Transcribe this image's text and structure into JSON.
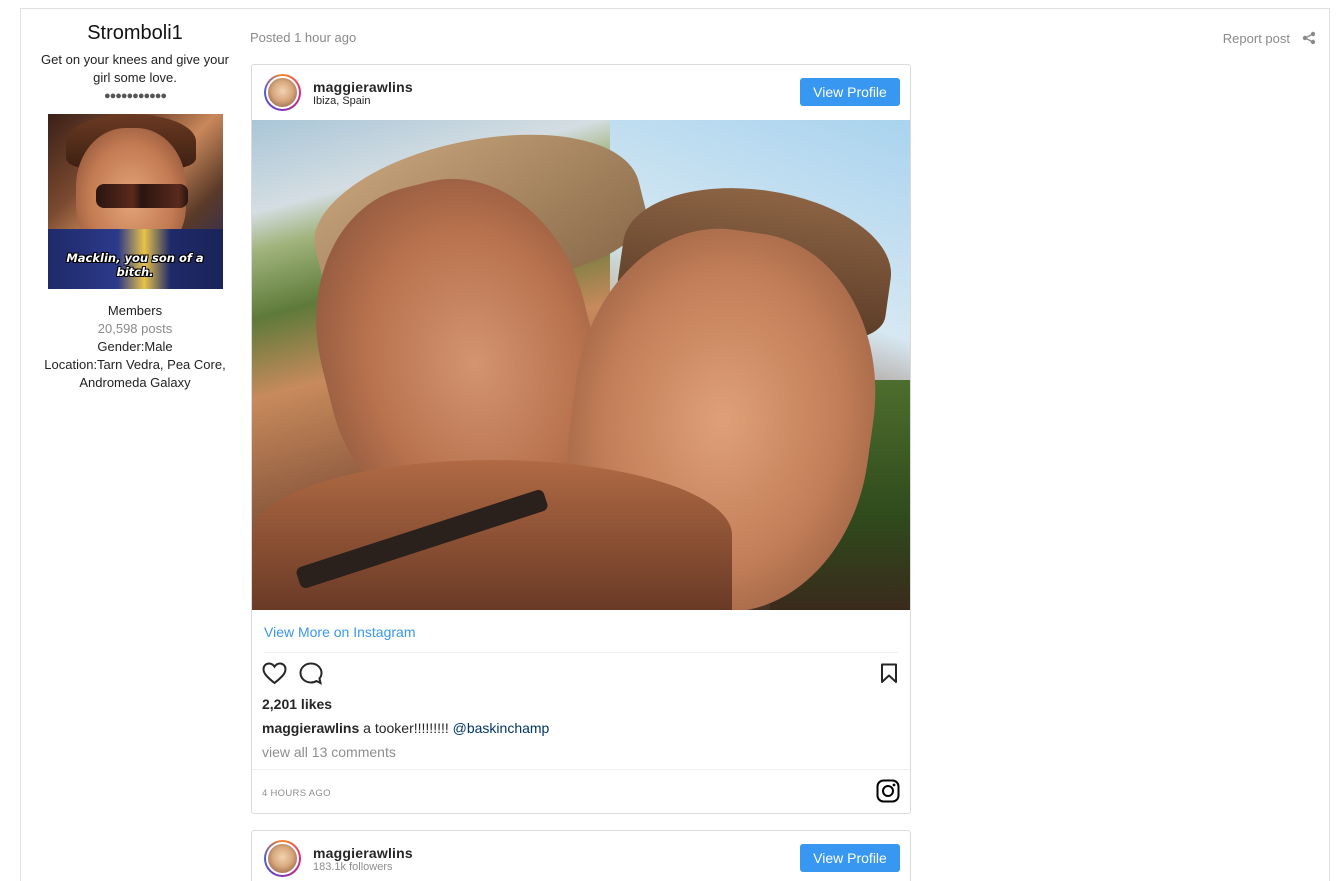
{
  "author": {
    "name": "Stromboli1",
    "title": "Get on your knees and give your girl some love.",
    "rank_pips": "●●●●●●●●●●●",
    "avatar_caption": "Macklin, you son of a bitch.",
    "group": "Members",
    "post_count": "20,598 posts",
    "gender": "Gender:Male",
    "location": "Location:Tarn Vedra, Pea Core, Andromeda Galaxy"
  },
  "post": {
    "posted": "Posted 1 hour ago",
    "report_label": "Report post",
    "share_icon": "share-icon"
  },
  "embeds": [
    {
      "username": "maggierawlins",
      "subtitle": "Ibiza, Spain",
      "view_profile": "View Profile",
      "view_more": "View More on Instagram",
      "likes": "2,201 likes",
      "caption_user": "maggierawlins",
      "caption_text": " a tooker!!!!!!!!! ",
      "caption_tag": "@baskinchamp",
      "comments": "view all 13 comments",
      "time": "4 HOURS AGO"
    },
    {
      "username": "maggierawlins",
      "subtitle": "183.1k followers",
      "view_profile": "View Profile"
    }
  ],
  "colors": {
    "accent": "#3897f0",
    "muted": "#8e8e8e",
    "border": "#dbdbdb"
  }
}
